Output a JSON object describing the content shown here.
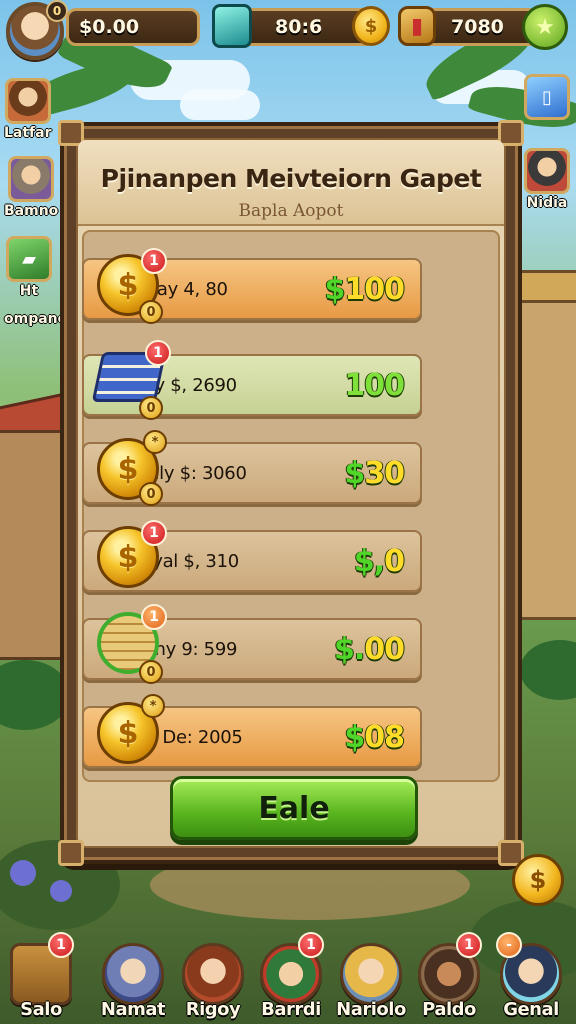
{
  "top_bar": {
    "level": "0",
    "cash_value": "$0.00",
    "gems_value": "80:6",
    "coin_symbol": "$",
    "potions_value": "7080"
  },
  "side_left": [
    {
      "label": "Latfar"
    },
    {
      "label": "Bamno"
    },
    {
      "label": "Ht"
    },
    {
      "label": "ompanc"
    }
  ],
  "side_right": [
    {
      "label": "Nidia"
    }
  ],
  "panel": {
    "title": "Pjinanpen Meivteiorn Gapet",
    "subtitle": "Bapla Aopot",
    "rows": [
      {
        "name": "Stauday 4, 80",
        "price_dollar": "$",
        "price_num": "100",
        "badge": "1",
        "corner": "0",
        "icon": "coin-stack-icon"
      },
      {
        "name": "Saleny $, 2690",
        "price_dollar": "",
        "price_num": "100",
        "badge": "1",
        "corner": "0",
        "icon": "book-stack-icon"
      },
      {
        "name": "IManuly $: 3060",
        "price_dollar": "$",
        "price_num": "30",
        "badge": "*",
        "corner": "0",
        "icon": "coin-stack-icon"
      },
      {
        "name": "Deenyal $, 310",
        "price_dollar": "$,",
        "price_num": "0",
        "badge": "1",
        "corner": "",
        "icon": "coin-stack-icon"
      },
      {
        "name": "Sepainy 9: 599",
        "price_dollar": "$.",
        "price_num": "00",
        "badge": "1",
        "corner": "0",
        "icon": "gold-bars-icon"
      },
      {
        "name": "Narce De: 2005",
        "price_dollar": "$",
        "price_num": "08",
        "badge": "*",
        "corner": "",
        "icon": "coin-stack-icon"
      }
    ],
    "sale_button": "Eale"
  },
  "float_coin_symbol": "$",
  "bottom_nav": [
    {
      "label": "Salo",
      "badge": "1"
    },
    {
      "label": "Namat",
      "badge": ""
    },
    {
      "label": "Rigoy",
      "badge": ""
    },
    {
      "label": "Barrdi",
      "badge": "1"
    },
    {
      "label": "Nariolo",
      "badge": ""
    },
    {
      "label": "Paldo",
      "badge": "1"
    },
    {
      "label": "Genal",
      "badge": "-"
    }
  ],
  "colors": {
    "price_green": "#4fd629",
    "price_yellow": "#ffdc2a",
    "sale_button_green": "#58b41e",
    "panel_wood": "#5e4126"
  }
}
